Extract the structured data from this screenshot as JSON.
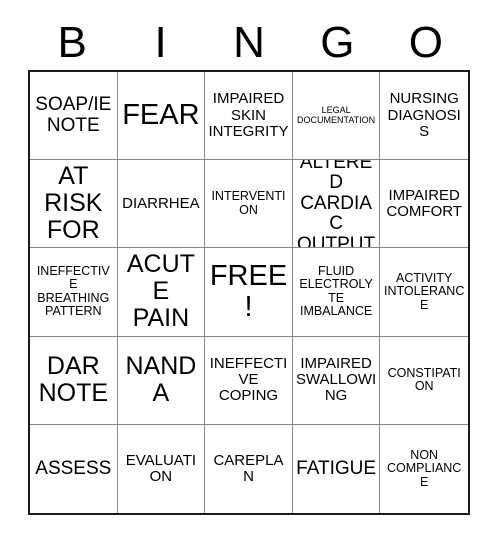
{
  "header": {
    "letters": [
      "B",
      "I",
      "N",
      "G",
      "O"
    ]
  },
  "grid": {
    "rows": [
      [
        {
          "text": "SOAP/IE\nNOTE",
          "size": "lg"
        },
        {
          "text": "FEAR",
          "size": "xxl"
        },
        {
          "text": "IMPAIRED\nSKIN\nINTEGRITY",
          "size": "md"
        },
        {
          "text": "LEGAL\nDOCUMENTATION",
          "size": "xs"
        },
        {
          "text": "NURSING\nDIAGNOSIS",
          "size": "md"
        }
      ],
      [
        {
          "text": "AT\nRISK\nFOR",
          "size": "xl"
        },
        {
          "text": "DIARRHEA",
          "size": "md"
        },
        {
          "text": "INTERVENTION",
          "size": "sm"
        },
        {
          "text": "ALTERED\nCARDIAC\nOUTPUT",
          "size": "lg"
        },
        {
          "text": "IMPAIRED\nCOMFORT",
          "size": "md"
        }
      ],
      [
        {
          "text": "INEFFECTIVE\nBREATHING\nPATTERN",
          "size": "sm"
        },
        {
          "text": "ACUTE\nPAIN",
          "size": "xl"
        },
        {
          "text": "FREE!",
          "size": "free"
        },
        {
          "text": "FLUID\nELECTROLYTE\nIMBALANCE",
          "size": "sm"
        },
        {
          "text": "ACTIVITY\nINTOLERANCE",
          "size": "sm"
        }
      ],
      [
        {
          "text": "DAR\nNOTE",
          "size": "xl"
        },
        {
          "text": "NANDA",
          "size": "xl"
        },
        {
          "text": "INEFFECTIVE\nCOPING",
          "size": "md"
        },
        {
          "text": "IMPAIRED\nSWALLOWING",
          "size": "md"
        },
        {
          "text": "CONSTIPATION",
          "size": "sm"
        }
      ],
      [
        {
          "text": "ASSESS",
          "size": "lg"
        },
        {
          "text": "EVALUATION",
          "size": "md"
        },
        {
          "text": "CAREPLAN",
          "size": "md"
        },
        {
          "text": "FATIGUE",
          "size": "lg"
        },
        {
          "text": "NON\nCOMPLIANCE",
          "size": "sm"
        }
      ]
    ]
  },
  "colors": {
    "background": "#ffffff",
    "text": "#000000",
    "outer_border": "#1a1a1a",
    "inner_border": "#888888"
  }
}
